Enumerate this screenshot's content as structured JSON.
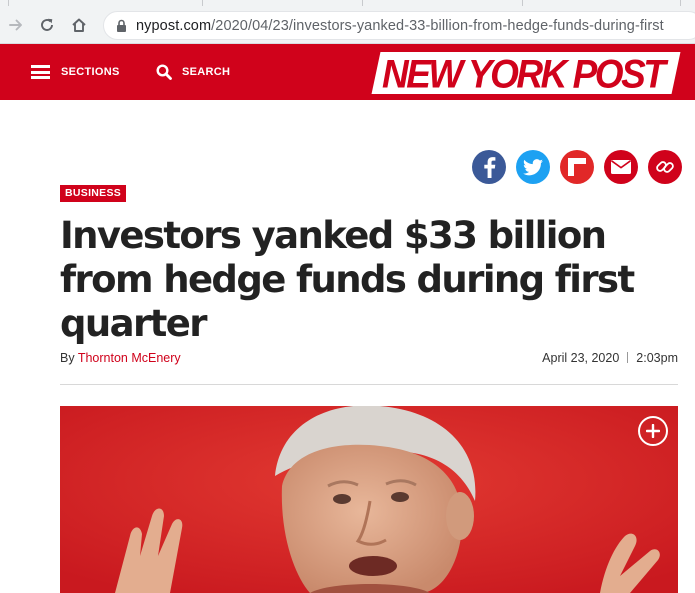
{
  "browser": {
    "url_host": "nypost.com",
    "url_path": "/2020/04/23/investors-yanked-33-billion-from-hedge-funds-during-first",
    "icons": [
      "forward-icon",
      "reload-icon",
      "home-icon",
      "lock-icon"
    ]
  },
  "header": {
    "sections_label": "SECTIONS",
    "search_label": "SEARCH",
    "logo_text": "NEW YORK POST",
    "colors": {
      "brand_red": "#d0021b"
    }
  },
  "share": {
    "icons": [
      "facebook-icon",
      "twitter-icon",
      "flipboard-icon",
      "email-icon",
      "link-icon"
    ],
    "colors": {
      "facebook": "#3b5998",
      "twitter": "#1da1f2",
      "flipboard": "#e12828",
      "email": "#d0021b",
      "link": "#d0021b"
    }
  },
  "article": {
    "category": "BUSINESS",
    "headline": "Investors yanked $33 billion from hedge funds during first quarter",
    "byline_prefix": "By",
    "author": "Thornton McEnery",
    "date": "April 23, 2020",
    "time": "2:03pm"
  },
  "photo": {
    "expand_icon": "expand-plus-icon"
  }
}
